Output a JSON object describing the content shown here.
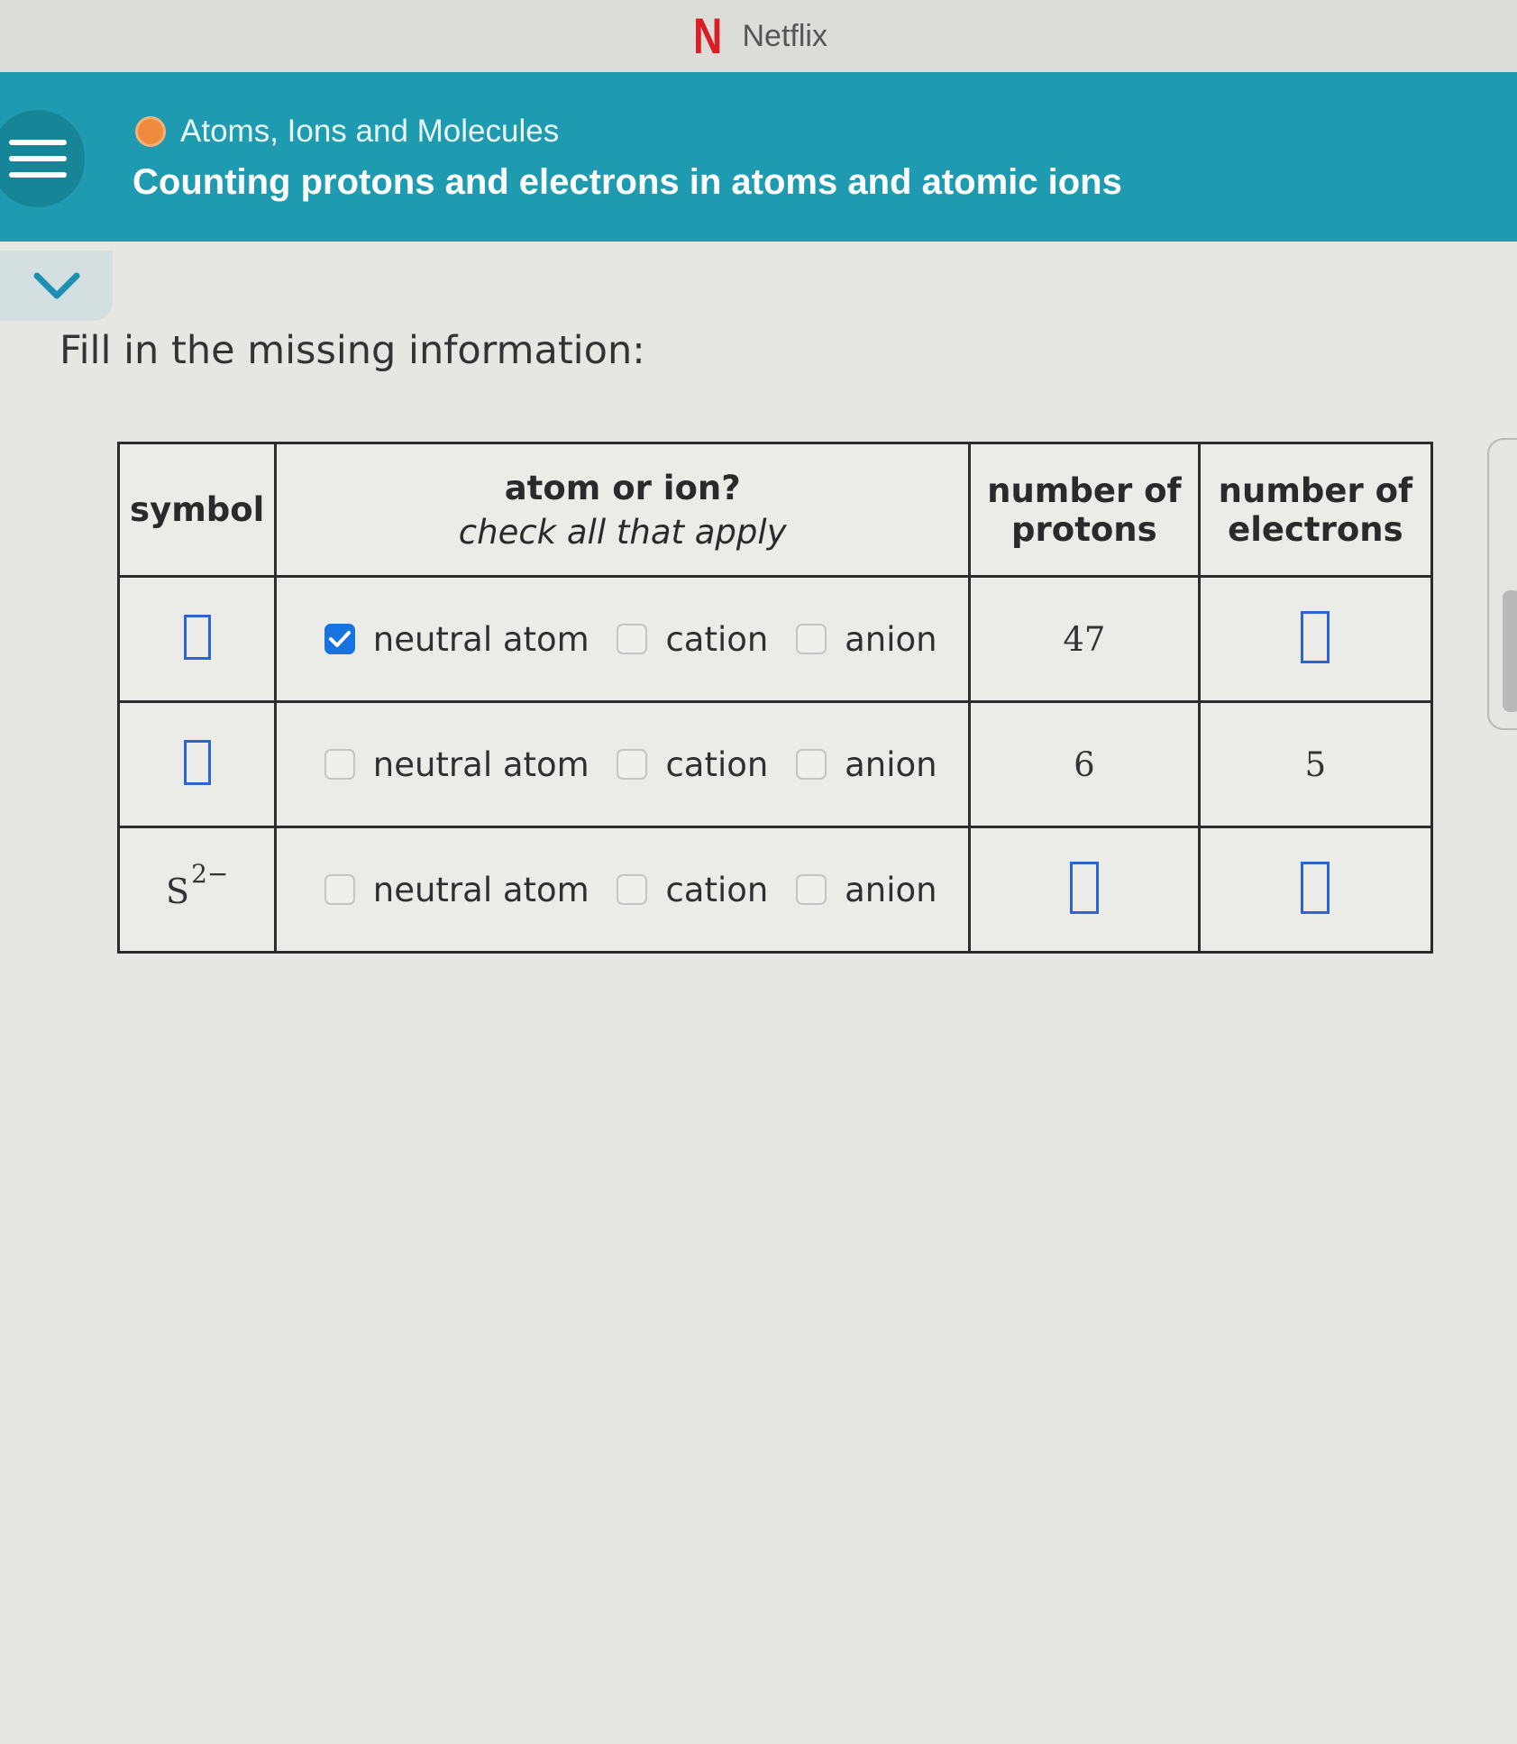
{
  "app": {
    "name": "Netflix"
  },
  "header": {
    "topic": "Atoms, Ions and Molecules",
    "title": "Counting protons and electrons in atoms and atomic ions"
  },
  "instruction": "Fill in the missing information:",
  "table": {
    "headers": {
      "symbol": "symbol",
      "atom_or_ion": "atom or ion?",
      "atom_or_ion_sub": "check all that apply",
      "protons": "number of protons",
      "electrons": "number of electrons"
    },
    "choice_labels": [
      "neutral atom",
      "cation",
      "anion"
    ],
    "rows": [
      {
        "symbol": "",
        "checked": [
          true,
          false,
          false
        ],
        "protons": "47",
        "electrons": ""
      },
      {
        "symbol": "",
        "checked": [
          false,
          false,
          false
        ],
        "protons": "6",
        "electrons": "5"
      },
      {
        "symbol": "S",
        "symbol_charge": "2−",
        "checked": [
          false,
          false,
          false
        ],
        "protons": "",
        "electrons": ""
      }
    ]
  },
  "colors": {
    "header_bg": "#1e9bb0",
    "topic_dot": "#f08a3c",
    "checkbox_checked": "#1673e0",
    "answer_box_border": "#2b63d9",
    "netflix_red": "#d81f26"
  },
  "icons": [
    "netflix-logo-icon",
    "menu-icon",
    "chevron-down-icon",
    "checkmark-icon"
  ]
}
